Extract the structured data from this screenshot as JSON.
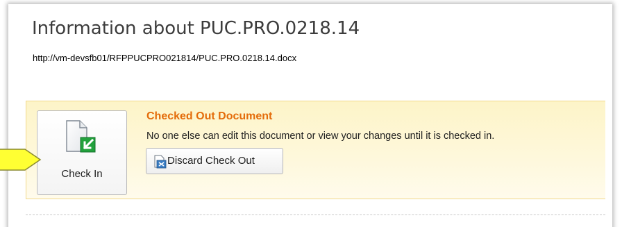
{
  "info": {
    "title": "Information about PUC.PRO.0218.14",
    "url": "http://vm-devsfb01/RFPPUCPRO021814/PUC.PRO.0218.14.docx"
  },
  "notice": {
    "title": "Checked Out Document",
    "message": "No one else can edit this document or view your changes until it is checked in.",
    "discard_label": "Discard Check Out"
  },
  "checkin": {
    "label": "Check In"
  },
  "colors": {
    "notice_title": "#e46c0a",
    "notice_bg": "#fdf4c8",
    "notice_border": "#f1d88a",
    "arrow_fill": "#ffff33",
    "icon_accent": "#22a13c"
  },
  "icons": {
    "checkin": "document-checkin-icon",
    "discard": "discard-checkout-icon",
    "pointer": "callout-arrow-icon"
  }
}
